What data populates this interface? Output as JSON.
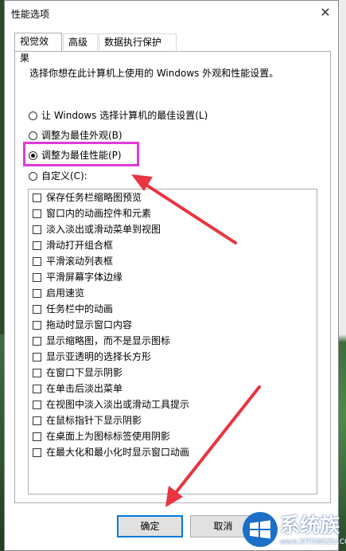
{
  "window": {
    "title": "性能选项",
    "close_glyph": "✕"
  },
  "tabs": [
    {
      "label": "视觉效果",
      "active": true
    },
    {
      "label": "高级",
      "active": false
    },
    {
      "label": "数据执行保护",
      "active": false
    }
  ],
  "description": "选择你想在此计算机上使用的 Windows 外观和性能设置。",
  "radio_options": [
    {
      "label": "让 Windows 选择计算机的最佳设置(L)",
      "checked": false
    },
    {
      "label": "调整为最佳外观(B)",
      "checked": false
    },
    {
      "label": "调整为最佳性能(P)",
      "checked": true
    },
    {
      "label": "自定义(C):",
      "checked": false
    }
  ],
  "effects": [
    {
      "label": "保存任务栏缩略图预览",
      "checked": false
    },
    {
      "label": "窗口内的动画控件和元素",
      "checked": false
    },
    {
      "label": "淡入淡出或滑动菜单到视图",
      "checked": false
    },
    {
      "label": "滑动打开组合框",
      "checked": false
    },
    {
      "label": "平滑滚动列表框",
      "checked": false
    },
    {
      "label": "平滑屏幕字体边缘",
      "checked": false
    },
    {
      "label": "启用速览",
      "checked": false
    },
    {
      "label": "任务栏中的动画",
      "checked": false
    },
    {
      "label": "拖动时显示窗口内容",
      "checked": false
    },
    {
      "label": "显示缩略图，而不是显示图标",
      "checked": false
    },
    {
      "label": "显示亚透明的选择长方形",
      "checked": false
    },
    {
      "label": "在窗口下显示阴影",
      "checked": false
    },
    {
      "label": "在单击后淡出菜单",
      "checked": false
    },
    {
      "label": "在视图中淡入淡出或滑动工具提示",
      "checked": false
    },
    {
      "label": "在鼠标指针下显示阴影",
      "checked": false
    },
    {
      "label": "在桌面上为图标标签使用阴影",
      "checked": false
    },
    {
      "label": "在最大化和最小化时显示窗口动画",
      "checked": false
    }
  ],
  "buttons": {
    "ok": "确定",
    "cancel": "取消"
  },
  "watermark": {
    "main": "系统族",
    "sub": "www.XITONGZU.COM"
  },
  "colors": {
    "highlight": "#e03ad8",
    "arrow": "#e8353f",
    "ok_border": "#0078d7"
  }
}
